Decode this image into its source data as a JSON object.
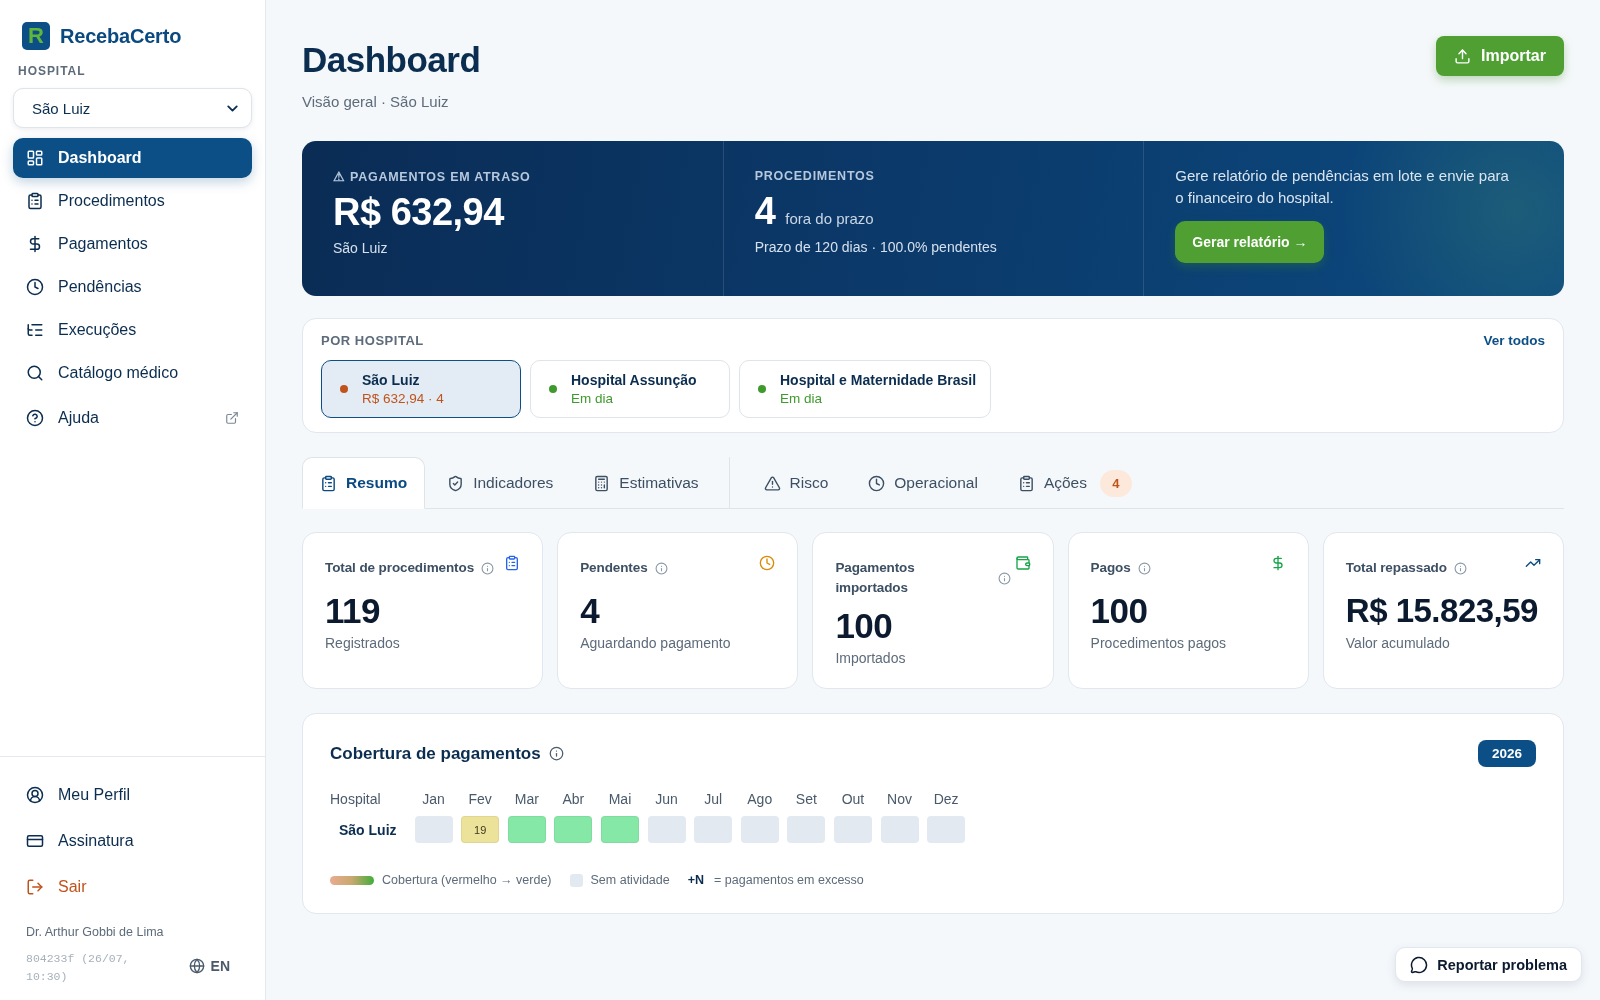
{
  "brand": {
    "logo_letter": "R",
    "name": "RecebaCerto"
  },
  "sidebar": {
    "hospital_label": "HOSPITAL",
    "hospital_select": {
      "value": "São Luiz"
    },
    "nav": [
      {
        "label": "Dashboard",
        "selected": true,
        "external": false
      },
      {
        "label": "Procedimentos",
        "selected": false,
        "external": false
      },
      {
        "label": "Pagamentos",
        "selected": false,
        "external": false
      },
      {
        "label": "Pendências",
        "selected": false,
        "external": false
      },
      {
        "label": "Execuções",
        "selected": false,
        "external": false
      },
      {
        "label": "Catálogo médico",
        "selected": false,
        "external": false
      },
      {
        "label": "Ajuda",
        "selected": false,
        "external": true
      }
    ],
    "footer_nav": [
      {
        "label": "Meu Perfil",
        "kind": "normal"
      },
      {
        "label": "Assinatura",
        "kind": "normal"
      },
      {
        "label": "Sair",
        "kind": "danger"
      }
    ],
    "user": "Dr. Arthur Gobbi de Lima",
    "build": "804233f (26/07, 10:30)",
    "language": "EN"
  },
  "header": {
    "title": "Dashboard",
    "subtitle": "Visão geral · São Luiz",
    "import_button": "Importar"
  },
  "hero": {
    "overdue": {
      "label": "⚠ PAGAMENTOS EM ATRASO",
      "value": "R$ 632,94",
      "caption": "São Luiz"
    },
    "procedures": {
      "label": "PROCEDIMENTOS",
      "value": "4",
      "unit": "fora do prazo",
      "caption": "Prazo de 120 dias · 100.0% pendentes"
    },
    "report": {
      "text": "Gere relatório de pendências em lote e envie para o financeiro do hospital.",
      "button": "Gerar relatório →"
    }
  },
  "by_hospital": {
    "title": "POR HOSPITAL",
    "link": "Ver todos",
    "hospitals": [
      {
        "name": "São Luiz",
        "status": "R$ 632,94 · 4",
        "color": "#c0531c",
        "selected": true
      },
      {
        "name": "Hospital Assunção",
        "status": "Em dia",
        "color": "#3f9a2d",
        "selected": false
      },
      {
        "name": "Hospital e Maternidade Brasil",
        "status": "Em dia",
        "color": "#3f9a2d",
        "selected": false
      }
    ]
  },
  "tab_groups": [
    {
      "tabs": [
        {
          "label": "Resumo",
          "selected": true
        },
        {
          "label": "Indicadores",
          "selected": false
        },
        {
          "label": "Estimativas",
          "selected": false
        }
      ]
    },
    {
      "tabs": [
        {
          "label": "Risco",
          "selected": false
        },
        {
          "label": "Operacional",
          "selected": false
        },
        {
          "label": "Ações",
          "selected": false,
          "badge": "4"
        }
      ]
    }
  ],
  "stats": [
    {
      "label": "Total de procedimentos",
      "value": "119",
      "caption": "Registrados"
    },
    {
      "label": "Pendentes",
      "value": "4",
      "caption": "Aguardando pagamento"
    },
    {
      "label": "Pagamentos importados",
      "value": "100",
      "caption": "Importados"
    },
    {
      "label": "Pagos",
      "value": "100",
      "caption": "Procedimentos pagos"
    },
    {
      "label": "Total repassado",
      "value": "R$ 15.823,59",
      "caption": "Valor acumulado"
    }
  ],
  "coverage": {
    "title": "Cobertura de pagamentos",
    "year": "2026",
    "hospital_header": "Hospital",
    "months": [
      "Jan",
      "Fev",
      "Mar",
      "Abr",
      "Mai",
      "Jun",
      "Jul",
      "Ago",
      "Set",
      "Out",
      "Nov",
      "Dez"
    ],
    "rows": [
      {
        "hospital": "São Luiz",
        "cells": [
          {
            "kind": "empty"
          },
          {
            "kind": "filled",
            "color": "#ece29a",
            "value": "19"
          },
          {
            "kind": "filled",
            "color": "#86e8a7"
          },
          {
            "kind": "filled",
            "color": "#86e8a7"
          },
          {
            "kind": "filled",
            "color": "#86e8a7"
          },
          {
            "kind": "empty"
          },
          {
            "kind": "empty"
          },
          {
            "kind": "empty"
          },
          {
            "kind": "empty"
          },
          {
            "kind": "empty"
          },
          {
            "kind": "empty"
          },
          {
            "kind": "empty"
          }
        ]
      }
    ],
    "legend": {
      "gradient": "Cobertura (vermelho → verde)",
      "empty": "Sem atividade",
      "excess_mark": "+N",
      "excess": "= pagamentos em excesso"
    }
  },
  "report_button": "Reportar problema"
}
